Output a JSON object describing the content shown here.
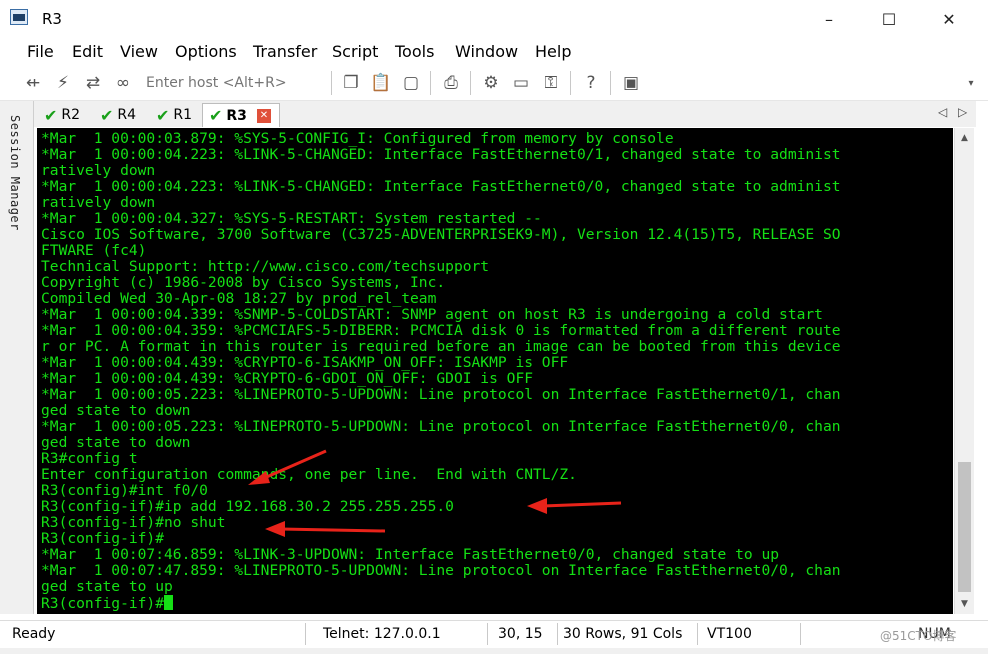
{
  "window": {
    "title": "R3",
    "controls": [
      "–",
      "☐",
      "✕"
    ]
  },
  "menu": [
    "File",
    "Edit",
    "View",
    "Options",
    "Transfer",
    "Script",
    "Tools",
    "Window",
    "Help"
  ],
  "toolbar": {
    "host_placeholder": "Enter host <Alt+R>"
  },
  "session_manager_label": "Session Manager",
  "tabs": [
    {
      "label": "R2",
      "active": false
    },
    {
      "label": "R4",
      "active": false
    },
    {
      "label": "R1",
      "active": false
    },
    {
      "label": "R3",
      "active": true
    }
  ],
  "terminal": {
    "lines": [
      "*Mar  1 00:00:03.879: %SYS-5-CONFIG_I: Configured from memory by console",
      "*Mar  1 00:00:04.223: %LINK-5-CHANGED: Interface FastEthernet0/1, changed state to administ",
      "ratively down",
      "*Mar  1 00:00:04.223: %LINK-5-CHANGED: Interface FastEthernet0/0, changed state to administ",
      "ratively down",
      "*Mar  1 00:00:04.327: %SYS-5-RESTART: System restarted --",
      "Cisco IOS Software, 3700 Software (C3725-ADVENTERPRISEK9-M), Version 12.4(15)T5, RELEASE SO",
      "FTWARE (fc4)",
      "Technical Support: http://www.cisco.com/techsupport",
      "Copyright (c) 1986-2008 by Cisco Systems, Inc.",
      "Compiled Wed 30-Apr-08 18:27 by prod_rel_team",
      "*Mar  1 00:00:04.339: %SNMP-5-COLDSTART: SNMP agent on host R3 is undergoing a cold start",
      "*Mar  1 00:00:04.359: %PCMCIAFS-5-DIBERR: PCMCIA disk 0 is formatted from a different route",
      "r or PC. A format in this router is required before an image can be booted from this device",
      "*Mar  1 00:00:04.439: %CRYPTO-6-ISAKMP_ON_OFF: ISAKMP is OFF",
      "*Mar  1 00:00:04.439: %CRYPTO-6-GDOI_ON_OFF: GDOI is OFF",
      "*Mar  1 00:00:05.223: %LINEPROTO-5-UPDOWN: Line protocol on Interface FastEthernet0/1, chan",
      "ged state to down",
      "*Mar  1 00:00:05.223: %LINEPROTO-5-UPDOWN: Line protocol on Interface FastEthernet0/0, chan",
      "ged state to down",
      "R3#config t",
      "Enter configuration commands, one per line.  End with CNTL/Z.",
      "R3(config)#int f0/0",
      "R3(config-if)#ip add 192.168.30.2 255.255.255.0",
      "R3(config-if)#no shut",
      "R3(config-if)#",
      "*Mar  1 00:07:46.859: %LINK-3-UPDOWN: Interface FastEthernet0/0, changed state to up",
      "*Mar  1 00:07:47.859: %LINEPROTO-5-UPDOWN: Line protocol on Interface FastEthernet0/0, chan",
      "ged state to up"
    ],
    "prompt": "R3(config-if)#"
  },
  "status": {
    "ready": "Ready",
    "connection": "Telnet: 127.0.0.1",
    "cursor_pos": "30, 15",
    "dimensions": "30 Rows, 91 Cols",
    "emulation": "VT100",
    "caps": "NUM",
    "watermark": "@51CTO博客"
  },
  "colors": {
    "terminal_fg": "#15e015",
    "terminal_bg": "#000000",
    "arrow": "#e8231a"
  }
}
